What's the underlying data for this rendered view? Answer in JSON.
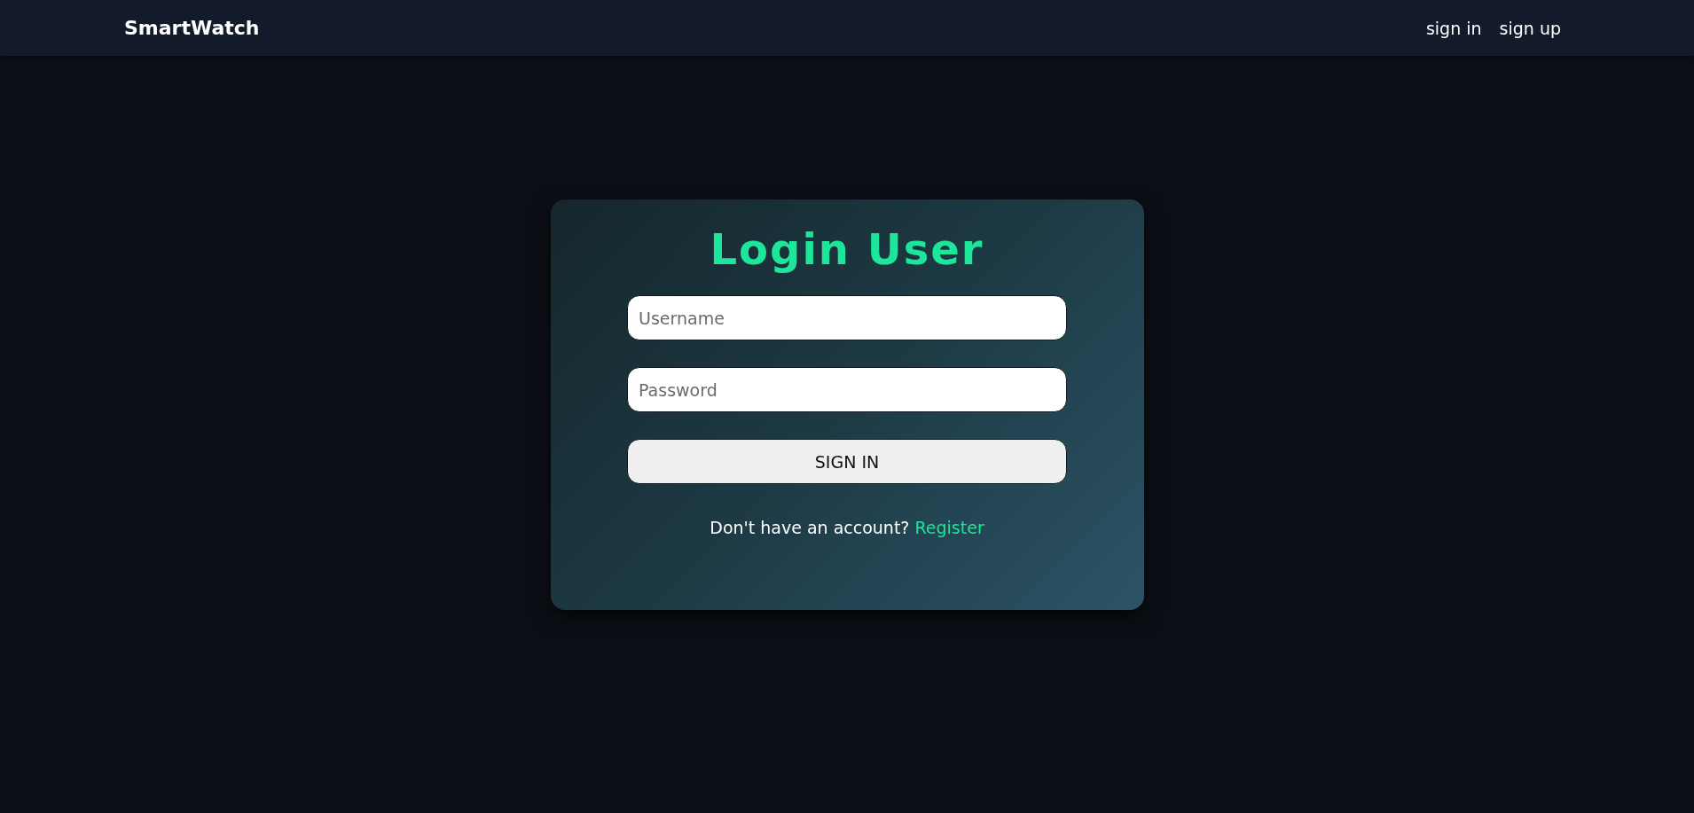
{
  "navbar": {
    "brand": "SmartWatch",
    "links": [
      "sign in",
      "sign up"
    ]
  },
  "login": {
    "title": "Login User",
    "fields": [
      {
        "placeholder": "Username"
      },
      {
        "placeholder": "Password"
      }
    ],
    "submit": "SIGN IN",
    "prompt": "Don't have an account?",
    "link": "Register"
  }
}
